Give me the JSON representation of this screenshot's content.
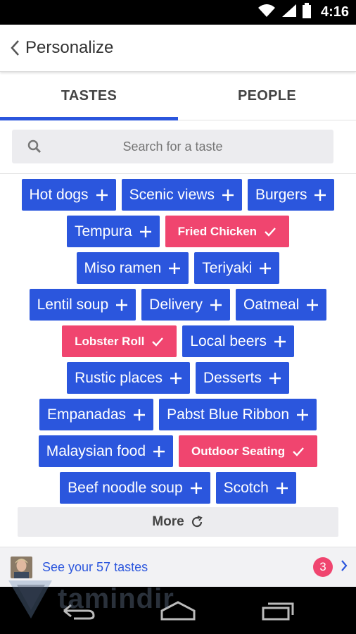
{
  "status_bar": {
    "time": "4:16"
  },
  "header": {
    "title": "Personalize"
  },
  "tabs": [
    {
      "label": "TASTES",
      "active": true
    },
    {
      "label": "PEOPLE",
      "active": false
    }
  ],
  "search": {
    "placeholder": "Search for a taste"
  },
  "tags": [
    [
      {
        "label": "Hot dogs",
        "selected": false
      },
      {
        "label": "Scenic views",
        "selected": false
      },
      {
        "label": "Burgers",
        "selected": false
      }
    ],
    [
      {
        "label": "Tempura",
        "selected": false
      },
      {
        "label": "Fried Chicken",
        "selected": true
      }
    ],
    [
      {
        "label": "Miso ramen",
        "selected": false
      },
      {
        "label": "Teriyaki",
        "selected": false
      }
    ],
    [
      {
        "label": "Lentil soup",
        "selected": false
      },
      {
        "label": "Delivery",
        "selected": false
      },
      {
        "label": "Oatmeal",
        "selected": false
      }
    ],
    [
      {
        "label": "Lobster Roll",
        "selected": true
      },
      {
        "label": "Local beers",
        "selected": false
      }
    ],
    [
      {
        "label": "Rustic places",
        "selected": false
      },
      {
        "label": "Desserts",
        "selected": false
      }
    ],
    [
      {
        "label": "Empanadas",
        "selected": false
      },
      {
        "label": "Pabst Blue Ribbon",
        "selected": false
      }
    ],
    [
      {
        "label": "Malaysian food",
        "selected": false
      },
      {
        "label": "Outdoor Seating",
        "selected": true
      }
    ],
    [
      {
        "label": "Beef noodle soup",
        "selected": false
      },
      {
        "label": "Scotch",
        "selected": false
      }
    ]
  ],
  "more": {
    "label": "More"
  },
  "footer": {
    "text": "See your 57 tastes",
    "badge": "3"
  },
  "watermark": {
    "text": "tamindir"
  },
  "colors": {
    "accent": "#2b56dd",
    "selected": "#f0456f",
    "badge": "#f0456f"
  },
  "icons": {
    "add": "plus-icon",
    "selected": "check-icon",
    "back": "chevron-left-icon",
    "search": "search-icon",
    "more": "refresh-icon",
    "footer_arrow": "chevron-right-icon"
  }
}
